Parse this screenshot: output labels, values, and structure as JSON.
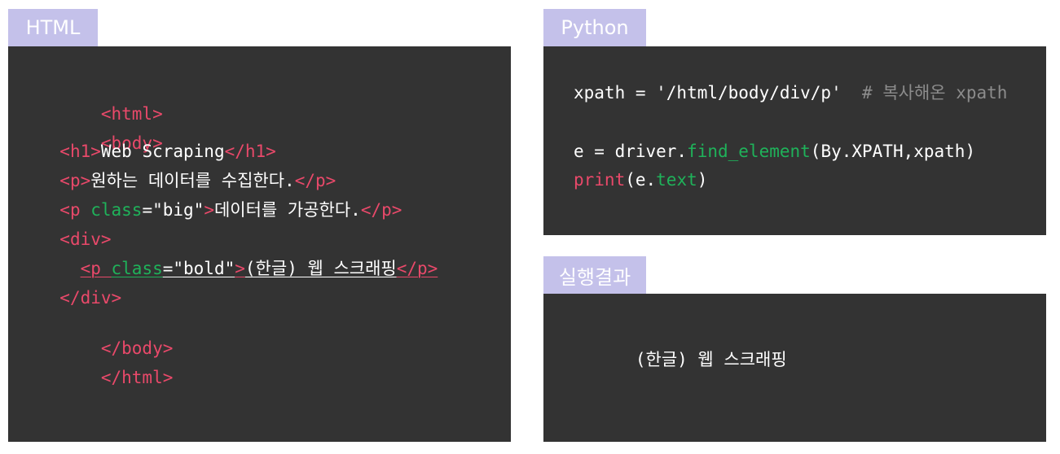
{
  "tabs": {
    "html": "HTML",
    "python": "Python",
    "result": "실행결과"
  },
  "html_code": {
    "l1_open": "<html>",
    "l2_open": "<body>",
    "l3_open": "<h1>",
    "l3_text": "Web Scraping",
    "l3_close": "</h1>",
    "l4_open": "<p>",
    "l4_text": "원하는 데이터를 수집한다.",
    "l4_close": "</p>",
    "l5_tag": "<p ",
    "l5_attr": "class",
    "l5_val": "=\"big\"",
    "l5_gt": ">",
    "l5_text": "데이터를 가공한다.",
    "l5_close": "</p>",
    "l6_open": "<div>",
    "l7_tag": "<p ",
    "l7_attr": "class",
    "l7_val": "=\"bold\"",
    "l7_gt": ">",
    "l7_text": "(한글) 웹 스크래핑",
    "l7_close": "</p>",
    "l8_close": "</div>",
    "l9_close": "</body>",
    "l10_close": "</html>"
  },
  "python_code": {
    "l1_code": "xpath = '/html/body/div/p'",
    "l1_comment": "# 복사해온 xpath",
    "l2_a": "e = driver.",
    "l2_fn": "find_element",
    "l2_b": "(By.XPATH,xpath)",
    "l3_kw": "print",
    "l3_a": "(e.",
    "l3_fn": "text",
    "l3_b": ")"
  },
  "result": {
    "output": "(한글) 웹 스크래핑"
  },
  "colors": {
    "tab_bg": "#c4c1ea",
    "panel_bg": "#333333",
    "tag": "#e9496a",
    "attr": "#1fb25a",
    "comment": "#8c8c8c"
  }
}
